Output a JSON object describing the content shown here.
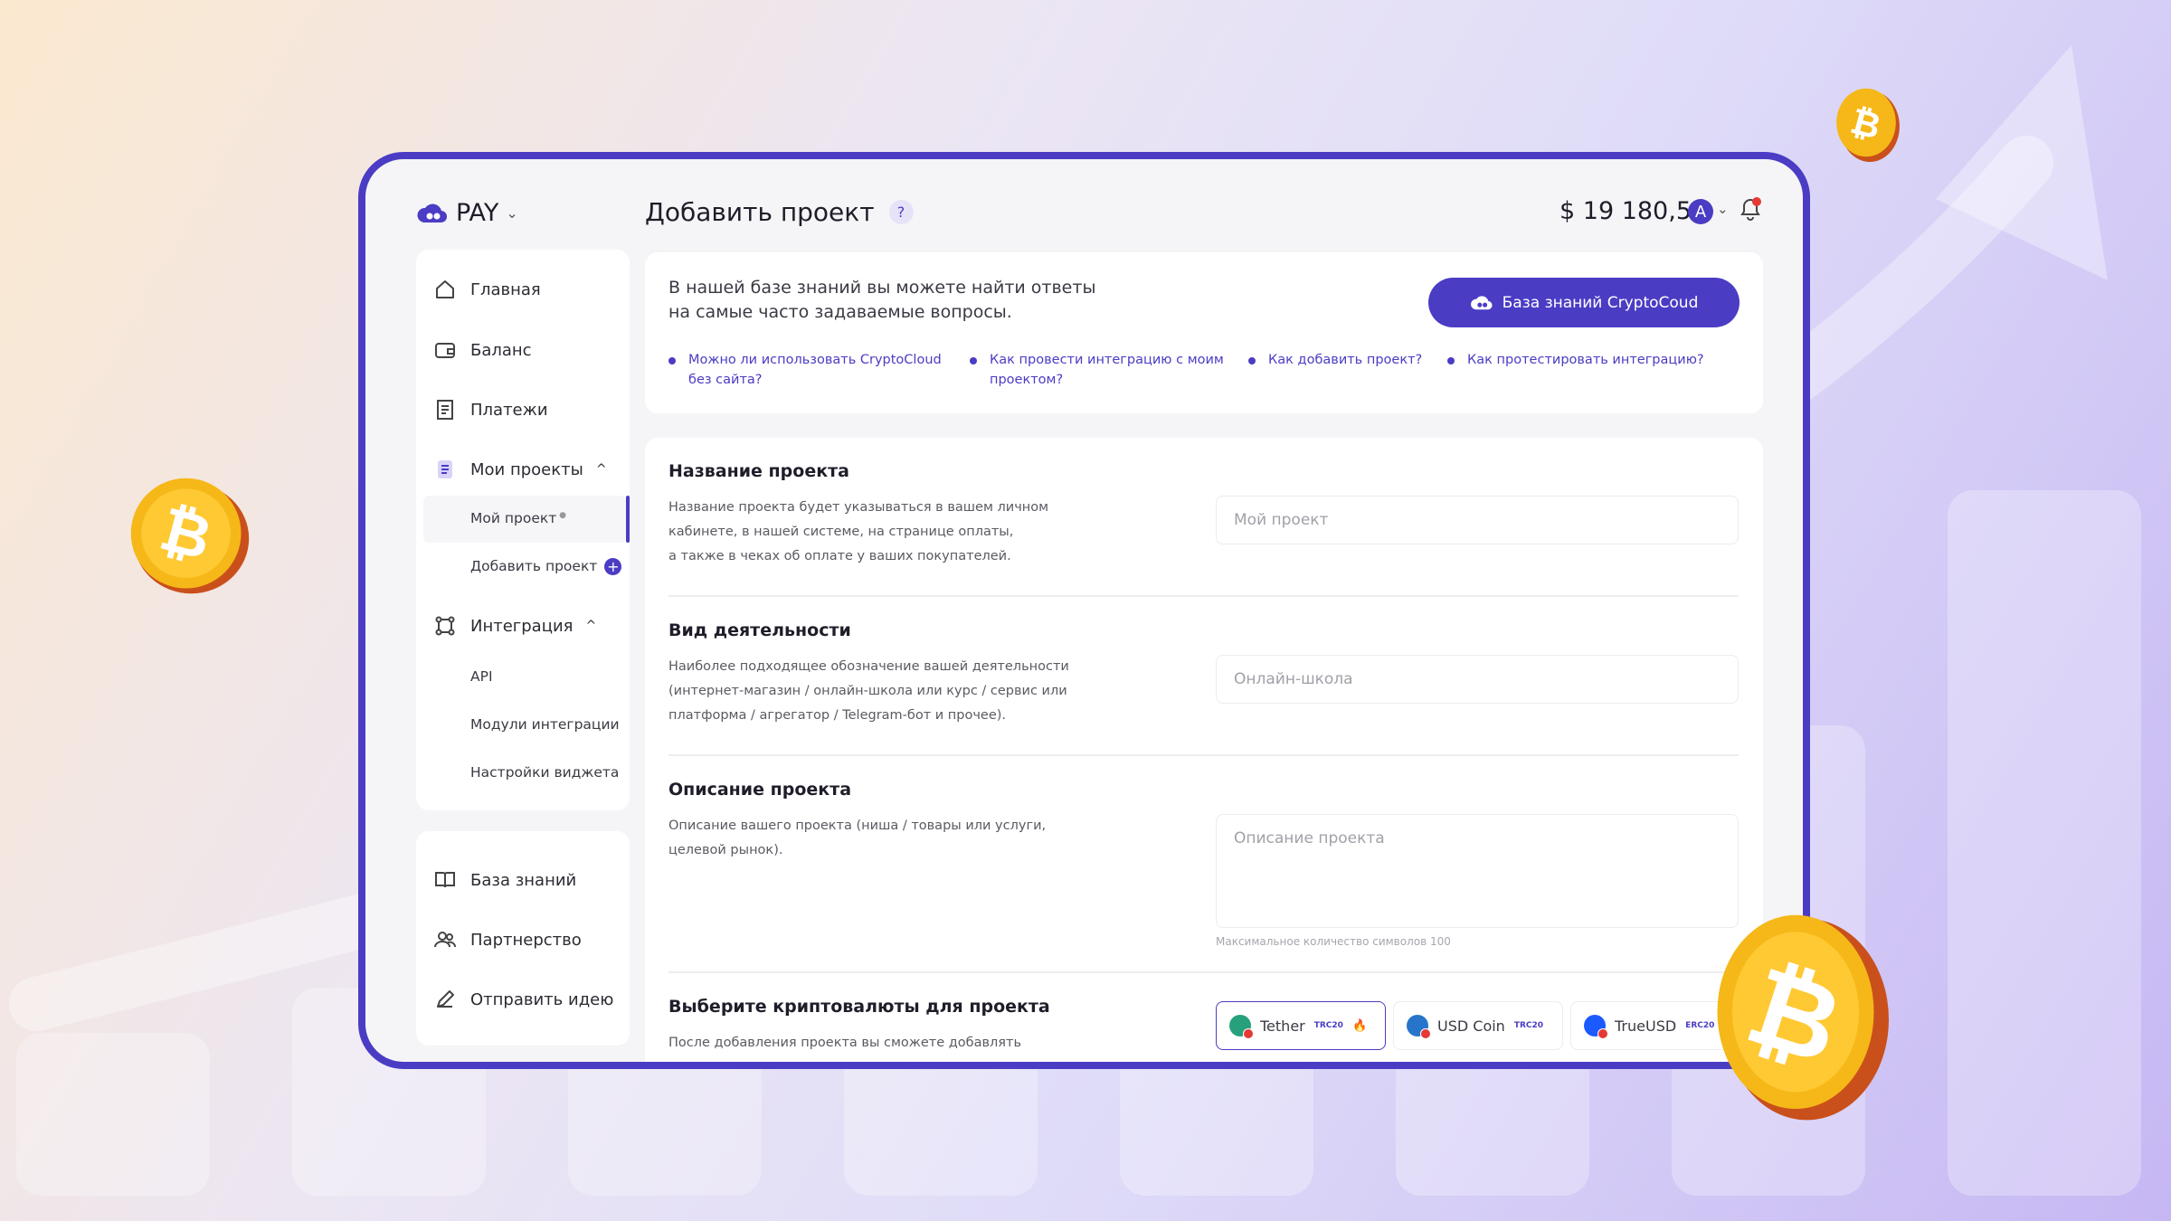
{
  "colors": {
    "accent": "#4b3cc4",
    "coin": "#f5b818"
  },
  "header": {
    "logo": "PAY",
    "title": "Добавить проект",
    "help": "?",
    "balance": "$ 19 180,50",
    "avatar": "A"
  },
  "sidebar": {
    "items": [
      {
        "label": "Главная",
        "icon": "home-icon"
      },
      {
        "label": "Баланс",
        "icon": "wallet-icon"
      },
      {
        "label": "Платежи",
        "icon": "receipt-icon"
      },
      {
        "label": "Мои проекты",
        "icon": "document-icon"
      }
    ],
    "projects_sub": [
      {
        "label": "Мой проект"
      },
      {
        "label": "Добавить проект"
      }
    ],
    "integration": {
      "label": "Интеграция",
      "icon": "integration-icon"
    },
    "integration_sub": [
      {
        "label": "API"
      },
      {
        "label": "Модули интеграции"
      },
      {
        "label": "Настройки виджета"
      }
    ],
    "bottom": [
      {
        "label": "База знаний",
        "icon": "book-icon"
      },
      {
        "label": "Партнерство",
        "icon": "people-icon"
      },
      {
        "label": "Отправить идею",
        "icon": "pencil-icon"
      }
    ]
  },
  "knowledge": {
    "line1": "В нашей базе знаний вы можете найти ответы",
    "line2": "на самые часто задаваемые вопросы.",
    "button": "База знаний CryptoCoud",
    "faq": [
      {
        "l1": "Можно ли использовать CryptoCloud",
        "l2": "без сайта?"
      },
      {
        "l1": "Как провести интеграцию с моим",
        "l2": "проектом?"
      },
      {
        "l1": "Как добавить проект?",
        "l2": ""
      },
      {
        "l1": "Как протестировать интеграцию?",
        "l2": ""
      }
    ]
  },
  "form": {
    "name": {
      "title": "Название проекта",
      "desc1": "Название проекта будет указываться в вашем личном",
      "desc2": "кабинете, в нашей системе, на странице оплаты,",
      "desc3": "а также в чеках об оплате у ваших покупателей.",
      "placeholder": "Мой проект"
    },
    "activity": {
      "title": "Вид деятельности",
      "desc1": "Наиболее подходящее обозначение вашей деятельности",
      "desc2": "(интернет-магазин / онлайн-школа или курс / сервис или",
      "desc3": "платформа / агрегатор / Telegram-бот и прочее).",
      "placeholder": "Онлайн-школа"
    },
    "description": {
      "title": "Описание проекта",
      "desc1": "Описание вашего проекта (ниша / товары или услуги,",
      "desc2": "целевой рынок).",
      "placeholder": "Описание проекта",
      "hint": "Максимальное количество символов 100"
    },
    "crypto": {
      "title": "Выберите криптовалюты для проекта",
      "desc1": "После добавления проекта вы сможете добавлять",
      "tokens": [
        {
          "name": "Tether",
          "network": "TRC20",
          "color": "#26a17b",
          "selected": true
        },
        {
          "name": "USD Coin",
          "network": "TRC20",
          "color": "#2775ca",
          "selected": false
        },
        {
          "name": "TrueUSD",
          "network": "ERC20",
          "color": "#1a5aff",
          "selected": false
        }
      ]
    }
  }
}
